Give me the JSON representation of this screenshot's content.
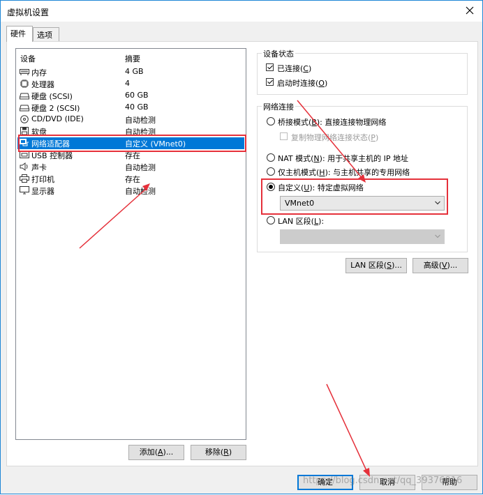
{
  "window": {
    "title": "虚拟机设置"
  },
  "tabs": [
    {
      "label": "硬件",
      "active": true
    },
    {
      "label": "选项",
      "active": false
    }
  ],
  "device_list": {
    "col_device": "设备",
    "col_summary": "摘要",
    "rows": [
      {
        "name": "内存",
        "summary": "4 GB",
        "icon": "memory-icon"
      },
      {
        "name": "处理器",
        "summary": "4",
        "icon": "processor-icon"
      },
      {
        "name": "硬盘 (SCSI)",
        "summary": "60 GB",
        "icon": "harddisk-icon"
      },
      {
        "name": "硬盘 2 (SCSI)",
        "summary": "40 GB",
        "icon": "harddisk-icon"
      },
      {
        "name": "CD/DVD (IDE)",
        "summary": "自动检测",
        "icon": "cd-icon"
      },
      {
        "name": "软盘",
        "summary": "自动检测",
        "icon": "floppy-icon"
      },
      {
        "name": "网络适配器",
        "summary": "自定义 (VMnet0)",
        "icon": "network-adapter-icon",
        "selected": true
      },
      {
        "name": "USB 控制器",
        "summary": "存在",
        "icon": "usb-icon"
      },
      {
        "name": "声卡",
        "summary": "自动检测",
        "icon": "sound-icon"
      },
      {
        "name": "打印机",
        "summary": "存在",
        "icon": "printer-icon"
      },
      {
        "name": "显示器",
        "summary": "自动检测",
        "icon": "display-icon"
      }
    ]
  },
  "buttons": {
    "add": {
      "text": "添加",
      "key": "A",
      "suffix": "..."
    },
    "remove": {
      "text": "移除",
      "key": "R",
      "suffix": ""
    },
    "lan_segments": {
      "text": "LAN 区段",
      "key": "S",
      "suffix": "..."
    },
    "advanced": {
      "text": "高级",
      "key": "V",
      "suffix": "..."
    },
    "ok": "确定",
    "cancel": "取消",
    "help": "帮助"
  },
  "device_status": {
    "title": "设备状态",
    "connected": {
      "text": "已连接",
      "key": "C",
      "checked": true
    },
    "connect_at_power_on": {
      "text": "启动时连接",
      "key": "O",
      "checked": true
    }
  },
  "network_connection": {
    "title": "网络连接",
    "bridged": {
      "text": "桥接模式",
      "key": "B",
      "desc": ": 直接连接物理网络"
    },
    "replicate": {
      "text": "复制物理网络连接状态",
      "key": "P"
    },
    "nat": {
      "text": "NAT 模式",
      "key": "N",
      "desc": ": 用于共享主机的 IP 地址"
    },
    "host_only": {
      "text": "仅主机模式",
      "key": "H",
      "desc": ": 与主机共享的专用网络"
    },
    "custom": {
      "text": "自定义",
      "key": "U",
      "desc": ": 特定虚拟网络",
      "selected": true
    },
    "custom_network_value": "VMnet0",
    "lan_segment": {
      "text": "LAN 区段",
      "key": "L",
      "desc": ":"
    },
    "lan_segment_value": ""
  },
  "watermark": "https://blog.csdn.net/qq_39376016",
  "colors": {
    "selection": "#0078d7",
    "highlight_box": "#e5303a",
    "window_border": "#1e86d6"
  }
}
